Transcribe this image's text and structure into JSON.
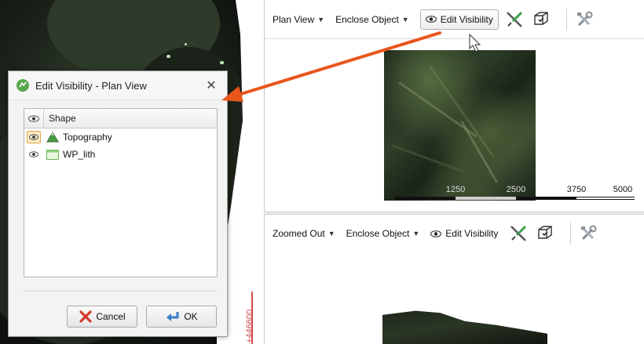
{
  "dialog": {
    "title": "Edit Visibility - Plan View",
    "close_label": "✕",
    "column_header": "Shape",
    "items": [
      {
        "label": "Topography",
        "visible": true,
        "icon": "topography-mountain-icon"
      },
      {
        "label": "WP_lith",
        "visible": true,
        "icon": "lith-table-icon"
      }
    ],
    "cancel_label": "Cancel",
    "ok_label": "OK"
  },
  "plan_view": {
    "view_menu": "Plan View",
    "enclose_menu": "Enclose Object",
    "edit_visibility_label": "Edit Visibility",
    "scale_labels": [
      "1250",
      "2500",
      "3750",
      "5000"
    ]
  },
  "zoomed_view": {
    "view_menu": "Zoomed Out",
    "enclose_menu": "Enclose Object",
    "edit_visibility_label": "Edit Visibility"
  },
  "scene": {
    "axis_label": "+446600"
  },
  "colors": {
    "arrow": "#e8561c",
    "axis": "#d24b4b",
    "highlight_border": "#e0a84a"
  }
}
